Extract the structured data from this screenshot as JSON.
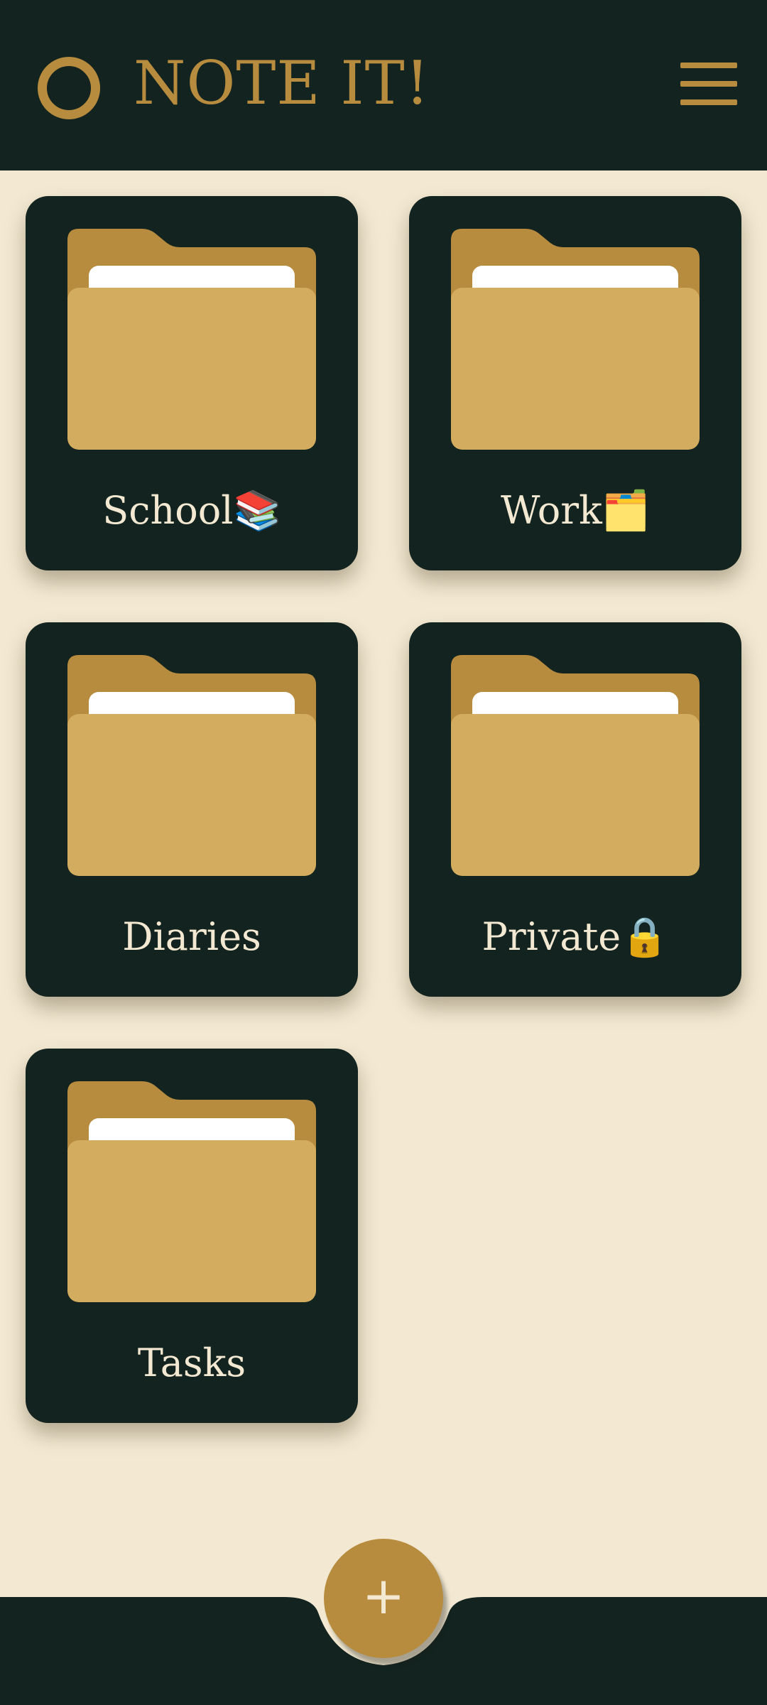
{
  "app": {
    "title": "NOTE IT!",
    "logo_icon": "ring-logo-icon",
    "menu_icon": "hamburger-menu-icon"
  },
  "colors": {
    "background": "#f3e9d2",
    "header": "#13231f",
    "accent": "#b88c3f",
    "folder_body": "#d4ac5f",
    "folder_back": "#b88c3f",
    "label_text": "#f3e9d2"
  },
  "folders": [
    {
      "label": "School📚",
      "icon": "folder-icon"
    },
    {
      "label": "Work🗂️",
      "icon": "folder-icon"
    },
    {
      "label": "Diaries",
      "icon": "folder-icon"
    },
    {
      "label": "Private🔒",
      "icon": "folder-icon"
    },
    {
      "label": "Tasks",
      "icon": "folder-icon"
    }
  ],
  "fab": {
    "symbol": "+",
    "icon": "plus-icon"
  }
}
